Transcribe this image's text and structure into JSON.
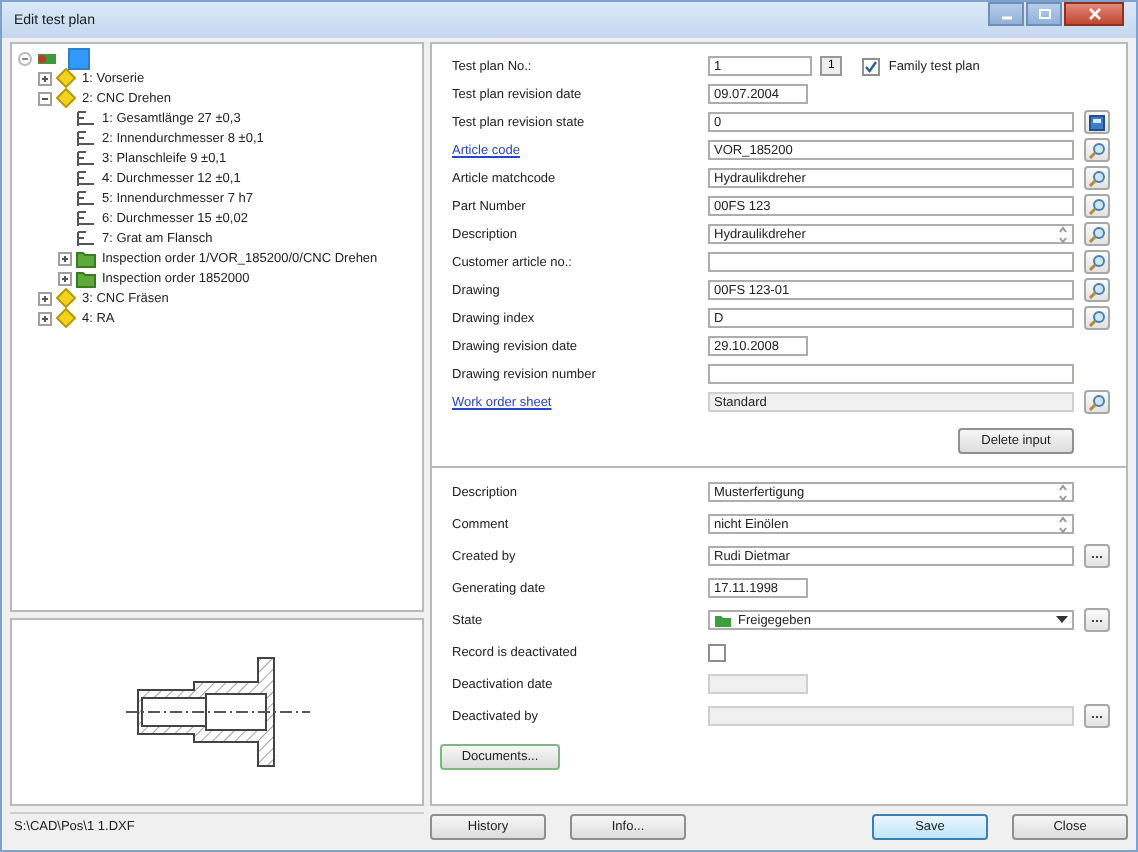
{
  "window": {
    "title": "Edit test plan"
  },
  "tree": [
    {
      "kind": "root",
      "expanded": true,
      "selected": true,
      "children": [
        {
          "kind": "operation",
          "label": "1: Vorserie",
          "expanded": false,
          "selected": false
        },
        {
          "kind": "operation",
          "label": "2: CNC Drehen",
          "expanded": true,
          "selected": false,
          "children": [
            {
              "kind": "characteristic",
              "label": "1: Gesamtlänge 27 ±0,3",
              "selected": false
            },
            {
              "kind": "characteristic",
              "label": "2: Innendurchmesser 8 ±0,1",
              "selected": false
            },
            {
              "kind": "characteristic",
              "label": "3: Planschleife 9 ±0,1",
              "selected": false
            },
            {
              "kind": "characteristic",
              "label": "4: Durchmesser 12 ±0,1",
              "selected": false
            },
            {
              "kind": "characteristic",
              "label": "5: Innendurchmesser 7 h7",
              "selected": false
            },
            {
              "kind": "characteristic",
              "label": "6: Durchmesser 15 ±0,02",
              "selected": false
            },
            {
              "kind": "characteristic",
              "label": "7: Grat am Flansch",
              "selected": false
            },
            {
              "kind": "order",
              "label": "Inspection order 1/VOR_185200/0/CNC Drehen",
              "expanded": false,
              "selected": false
            },
            {
              "kind": "order",
              "label": "Inspection order 1852000",
              "expanded": false,
              "selected": false
            }
          ]
        },
        {
          "kind": "operation",
          "label": "3: CNC Fräsen",
          "expanded": false,
          "selected": false
        },
        {
          "kind": "operation",
          "label": "4: RA",
          "expanded": false,
          "selected": false
        }
      ]
    }
  ],
  "status_bar": "S:\\CAD\\Pos\\1 1.DXF",
  "header_fields": [
    {
      "kind": "number",
      "label": "Test plan No.:",
      "value": "1",
      "spin": "1",
      "checkbox": {
        "label": "Family test plan",
        "checked": true
      }
    },
    {
      "kind": "date",
      "label": "Test plan revision date",
      "value": "09.07.2004"
    },
    {
      "kind": "text",
      "label": "Test plan revision state",
      "value": "0",
      "button": {
        "kind": "book"
      }
    },
    {
      "kind": "text",
      "label": "Article code",
      "link": true,
      "value": "VOR_185200",
      "button": {
        "kind": "lookup"
      }
    },
    {
      "kind": "text",
      "label": "Article matchcode",
      "value": "Hydraulikdreher",
      "button": {
        "kind": "lookup"
      }
    },
    {
      "kind": "text",
      "label": "Part Number",
      "value": "00FS 123",
      "button": {
        "kind": "lookup"
      }
    },
    {
      "kind": "memo",
      "label": "Description",
      "value": "Hydraulikdreher",
      "button": {
        "kind": "lookup"
      }
    },
    {
      "kind": "text",
      "label": "Customer article no.:",
      "button": {
        "kind": "lookup"
      }
    },
    {
      "kind": "text",
      "label": "Drawing",
      "value": "00FS 123-01",
      "button": {
        "kind": "lookup"
      }
    },
    {
      "kind": "text",
      "label": "Drawing index",
      "value": "D",
      "button": {
        "kind": "lookup"
      }
    },
    {
      "kind": "date",
      "label": "Drawing revision date",
      "value": "29.10.2008"
    },
    {
      "kind": "text",
      "label": "Drawing revision number"
    },
    {
      "kind": "text",
      "label": "Work order sheet",
      "link": true,
      "value": "Standard",
      "button": {
        "kind": "lookup"
      },
      "disabled": true
    }
  ],
  "delete_button": "Delete input",
  "detail_fields": [
    {
      "kind": "memo",
      "label": "Description",
      "value": "Musterfertigung"
    },
    {
      "kind": "memo",
      "label": "Comment",
      "value": "nicht Einölen"
    },
    {
      "kind": "text",
      "label": "Created by",
      "value": "Rudi Dietmar",
      "button": {
        "kind": "ellipsis"
      }
    },
    {
      "kind": "date",
      "label": "Generating date",
      "value": "17.11.1998"
    },
    {
      "kind": "combo",
      "label": "State",
      "value": "Freigegeben",
      "button": {
        "kind": "ellipsis"
      }
    },
    {
      "kind": "check",
      "label": "Record is deactivated",
      "checked": false
    },
    {
      "kind": "date",
      "label": "Deactivation date",
      "disabled": true
    },
    {
      "kind": "text",
      "label": "Deactivated by",
      "button": {
        "kind": "ellipsis"
      },
      "disabled": true
    }
  ],
  "documents_button": "Documents...",
  "footer_buttons": [
    {
      "label": "History",
      "default": false
    },
    {
      "label": "Info...",
      "default": false
    },
    {
      "label": "Save",
      "default": true
    },
    {
      "label": "Close",
      "default": false
    }
  ]
}
